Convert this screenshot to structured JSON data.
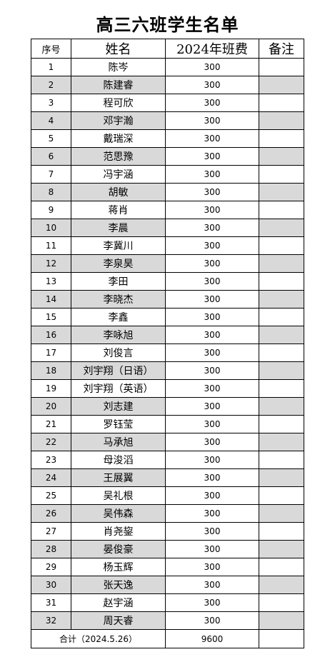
{
  "title": "高三六班学生名单",
  "headers": {
    "no": "序号",
    "name": "姓名",
    "fee": "2024年班费",
    "note": "备注"
  },
  "colors": {
    "shaded_row": "#d9d9d9",
    "border": "#000000"
  },
  "rows": [
    {
      "no": "1",
      "name": "陈岑",
      "fee": "300",
      "note": ""
    },
    {
      "no": "2",
      "name": "陈建睿",
      "fee": "300",
      "note": ""
    },
    {
      "no": "3",
      "name": "程可欣",
      "fee": "300",
      "note": ""
    },
    {
      "no": "4",
      "name": "邓宇瀚",
      "fee": "300",
      "note": ""
    },
    {
      "no": "5",
      "name": "戴瑞深",
      "fee": "300",
      "note": ""
    },
    {
      "no": "6",
      "name": "范思豫",
      "fee": "300",
      "note": ""
    },
    {
      "no": "7",
      "name": "冯宇涵",
      "fee": "300",
      "note": ""
    },
    {
      "no": "8",
      "name": "胡敏",
      "fee": "300",
      "note": ""
    },
    {
      "no": "9",
      "name": "蒋肖",
      "fee": "300",
      "note": ""
    },
    {
      "no": "10",
      "name": "李晨",
      "fee": "300",
      "note": ""
    },
    {
      "no": "11",
      "name": "李冀川",
      "fee": "300",
      "note": ""
    },
    {
      "no": "12",
      "name": "李泉昊",
      "fee": "300",
      "note": ""
    },
    {
      "no": "13",
      "name": "李田",
      "fee": "300",
      "note": ""
    },
    {
      "no": "14",
      "name": "李晓杰",
      "fee": "300",
      "note": ""
    },
    {
      "no": "15",
      "name": "李鑫",
      "fee": "300",
      "note": ""
    },
    {
      "no": "16",
      "name": "李咏旭",
      "fee": "300",
      "note": ""
    },
    {
      "no": "17",
      "name": "刘俊言",
      "fee": "300",
      "note": ""
    },
    {
      "no": "18",
      "name": "刘宇翔（日语）",
      "fee": "300",
      "note": ""
    },
    {
      "no": "19",
      "name": "刘宇翔（英语）",
      "fee": "300",
      "note": ""
    },
    {
      "no": "20",
      "name": "刘志建",
      "fee": "300",
      "note": ""
    },
    {
      "no": "21",
      "name": "罗钰莹",
      "fee": "300",
      "note": ""
    },
    {
      "no": "22",
      "name": "马承旭",
      "fee": "300",
      "note": ""
    },
    {
      "no": "23",
      "name": "母浚滔",
      "fee": "300",
      "note": ""
    },
    {
      "no": "24",
      "name": "王展翼",
      "fee": "300",
      "note": ""
    },
    {
      "no": "25",
      "name": "吴礼根",
      "fee": "300",
      "note": ""
    },
    {
      "no": "26",
      "name": "吴伟森",
      "fee": "300",
      "note": ""
    },
    {
      "no": "27",
      "name": "肖尧鋆",
      "fee": "300",
      "note": ""
    },
    {
      "no": "28",
      "name": "晏俊豪",
      "fee": "300",
      "note": ""
    },
    {
      "no": "29",
      "name": "杨玉辉",
      "fee": "300",
      "note": ""
    },
    {
      "no": "30",
      "name": "张天逸",
      "fee": "300",
      "note": ""
    },
    {
      "no": "31",
      "name": "赵宇涵",
      "fee": "300",
      "note": ""
    },
    {
      "no": "32",
      "name": "周天睿",
      "fee": "300",
      "note": ""
    }
  ],
  "total": {
    "label": "合计（2024.5.26）",
    "value": "9600",
    "note": ""
  }
}
